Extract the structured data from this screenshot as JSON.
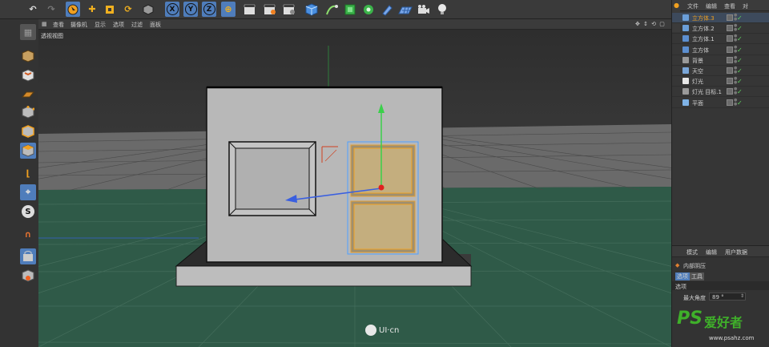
{
  "toolbar": {
    "axis_x": "X",
    "axis_y": "Y",
    "axis_z": "Z"
  },
  "viewport": {
    "menu": [
      "查看",
      "摄像机",
      "显示",
      "选项",
      "过滤",
      "面板"
    ],
    "title": "透视视图",
    "nav_icons": "✥ ↕ ⟲ ▢"
  },
  "object_manager": {
    "menu": [
      "文件",
      "编辑",
      "查看",
      "对"
    ],
    "objects": [
      {
        "name": "立方体.3",
        "color": "#6a9ed8",
        "selected": true
      },
      {
        "name": "立方体.2",
        "color": "#6a9ed8"
      },
      {
        "name": "立方体.1",
        "color": "#5c8fd0"
      },
      {
        "name": "立方体",
        "color": "#5c8fd0"
      },
      {
        "name": "背景",
        "color": "#9a9a9a"
      },
      {
        "name": "天空",
        "color": "#7aa6d8"
      },
      {
        "name": "灯光",
        "color": "#e8e8e8"
      },
      {
        "name": "灯光 目标.1",
        "color": "#9a9a9a"
      },
      {
        "name": "平面",
        "color": "#7fb3e6"
      }
    ]
  },
  "attribute_manager": {
    "menu": [
      "模式",
      "编辑",
      "用户数据"
    ],
    "tag_name": "内部阴压",
    "tabs": [
      "选项",
      "工具"
    ],
    "section": "选项",
    "field_label": "最大角度",
    "field_value": "89 °"
  },
  "watermark": {
    "text": "UI·cn",
    "brand": "PS",
    "brand2": "爱好者",
    "url": "www.psahz.com"
  }
}
